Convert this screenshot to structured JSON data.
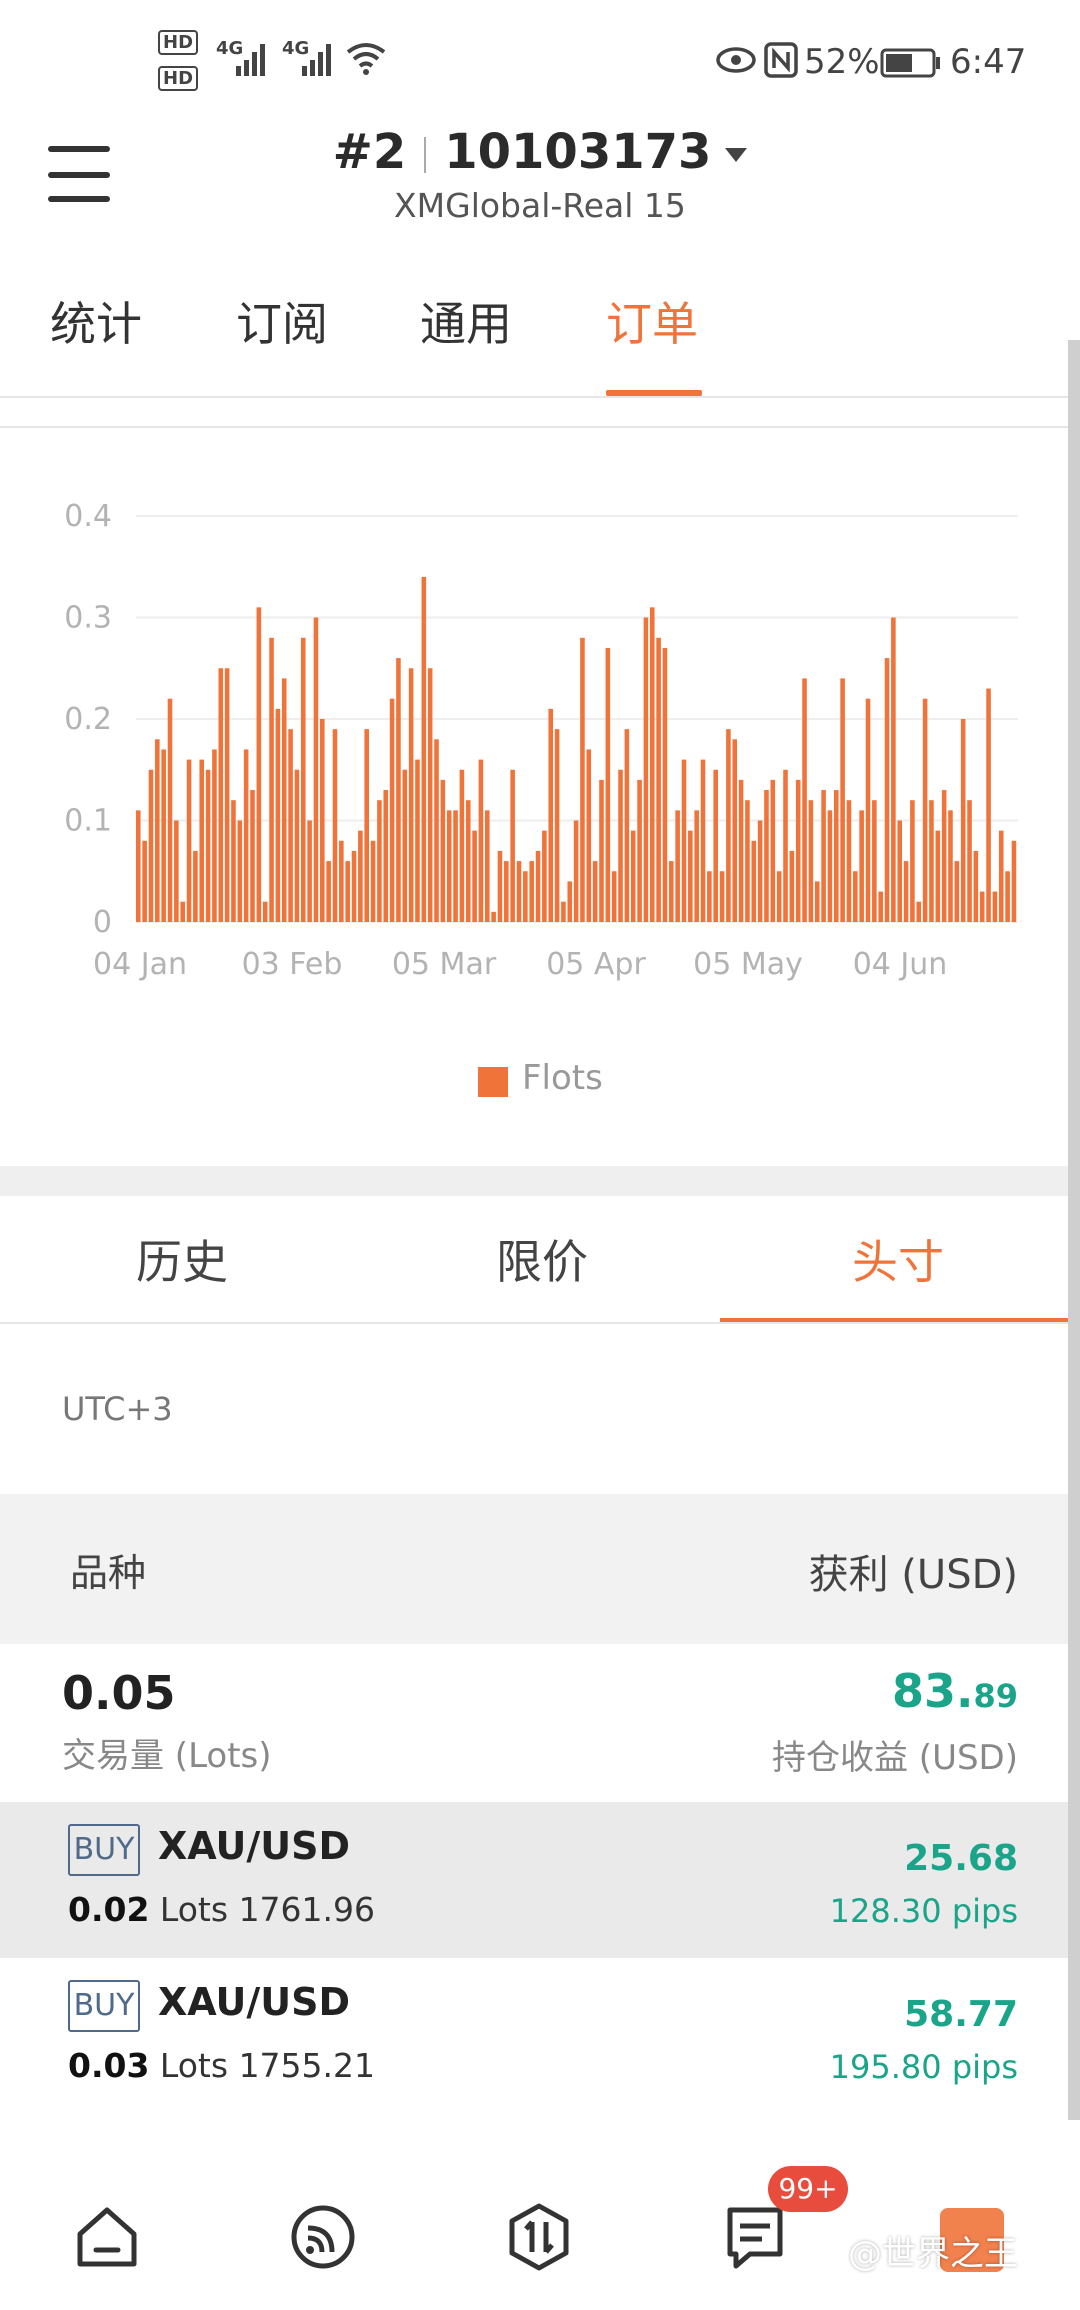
{
  "status_bar": {
    "hd1": "HD",
    "hd2": "HD",
    "sig1": "4G",
    "sig2": "4G",
    "battery": "52%",
    "time": "6:47"
  },
  "header": {
    "account_prefix": "#2",
    "account_number": "10103173",
    "server": "XMGlobal-Real 15"
  },
  "top_tabs": [
    {
      "label": "统计",
      "active": false
    },
    {
      "label": "订阅",
      "active": false
    },
    {
      "label": "通用",
      "active": false
    },
    {
      "label": "订单",
      "active": true
    }
  ],
  "chart_data": {
    "type": "bar",
    "series": [
      {
        "name": "Flots",
        "color": "#f0733a"
      }
    ],
    "y_ticks": [
      "0.4",
      "0.3",
      "0.2",
      "0.1",
      "0"
    ],
    "ylim": [
      0,
      0.4
    ],
    "x_ticks": [
      "04 Jan",
      "03 Feb",
      "05 Mar",
      "05 Apr",
      "05 May",
      "04 Jun"
    ],
    "grid": true,
    "legend_position": "bottom-center",
    "values": [
      0.11,
      0.08,
      0.15,
      0.18,
      0.17,
      0.22,
      0.1,
      0.02,
      0.16,
      0.07,
      0.16,
      0.15,
      0.17,
      0.25,
      0.25,
      0.12,
      0.1,
      0.17,
      0.13,
      0.31,
      0.02,
      0.28,
      0.21,
      0.24,
      0.19,
      0.15,
      0.28,
      0.1,
      0.3,
      0.2,
      0.06,
      0.19,
      0.08,
      0.06,
      0.07,
      0.09,
      0.19,
      0.08,
      0.12,
      0.13,
      0.22,
      0.26,
      0.15,
      0.25,
      0.16,
      0.34,
      0.25,
      0.18,
      0.14,
      0.11,
      0.11,
      0.15,
      0.12,
      0.09,
      0.16,
      0.11,
      0.01,
      0.07,
      0.06,
      0.15,
      0.06,
      0.05,
      0.06,
      0.07,
      0.09,
      0.21,
      0.19,
      0.02,
      0.04,
      0.1,
      0.28,
      0.17,
      0.06,
      0.14,
      0.27,
      0.05,
      0.15,
      0.19,
      0.09,
      0.14,
      0.3,
      0.31,
      0.28,
      0.27,
      0.06,
      0.11,
      0.16,
      0.09,
      0.11,
      0.16,
      0.05,
      0.15,
      0.05,
      0.19,
      0.18,
      0.14,
      0.12,
      0.08,
      0.1,
      0.13,
      0.14,
      0.05,
      0.15,
      0.07,
      0.14,
      0.24,
      0.12,
      0.04,
      0.13,
      0.11,
      0.13,
      0.24,
      0.12,
      0.05,
      0.11,
      0.22,
      0.12,
      0.03,
      0.26,
      0.3,
      0.1,
      0.06,
      0.12,
      0.02,
      0.22,
      0.12,
      0.09,
      0.13,
      0.11,
      0.06,
      0.2,
      0.12,
      0.07,
      0.03,
      0.23,
      0.03,
      0.09,
      0.05,
      0.08
    ]
  },
  "sub_tabs": [
    {
      "label": "历史",
      "active": false
    },
    {
      "label": "限价",
      "active": false
    },
    {
      "label": "头寸",
      "active": true
    }
  ],
  "timezone": "UTC+3",
  "table_header": {
    "symbol": "品种",
    "profit": "获利 (USD)"
  },
  "summary": {
    "volume": "0.05",
    "volume_label": "交易量 (Lots)",
    "profit_int": "83.",
    "profit_dec": "89",
    "profit_label": "持仓收益 (USD)"
  },
  "positions": [
    {
      "type": "BUY",
      "symbol": "XAU/USD",
      "lots": "0.02",
      "lots_label": "Lots",
      "price": "1761.96",
      "profit": "25.68",
      "pips": "128.30 pips"
    },
    {
      "type": "BUY",
      "symbol": "XAU/USD",
      "lots": "0.03",
      "lots_label": "Lots",
      "price": "1755.21",
      "profit": "58.77",
      "pips": "195.80 pips"
    }
  ],
  "bottom_nav": {
    "badge": "99+",
    "watermark": "@世界之王",
    "icons": [
      "home-icon",
      "signal-feed-icon",
      "trade-icon",
      "orders-icon",
      "app-logo-icon"
    ]
  }
}
